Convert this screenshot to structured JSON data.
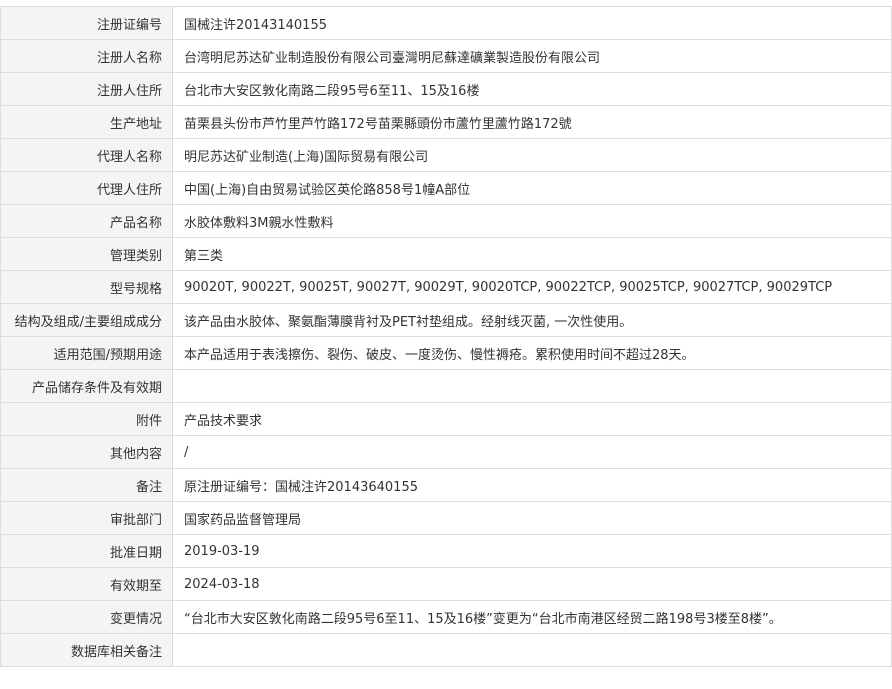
{
  "rows": [
    {
      "label": "注册证编号",
      "value": "国械注许20143140155"
    },
    {
      "label": "注册人名称",
      "value": "台湾明尼苏达矿业制造股份有限公司臺灣明尼蘇達礦業製造股份有限公司"
    },
    {
      "label": "注册人住所",
      "value": "台北市大安区敦化南路二段95号6至11、15及16楼"
    },
    {
      "label": "生产地址",
      "value": "苗栗县头份市芦竹里芦竹路172号苗栗縣頭份市蘆竹里蘆竹路172號"
    },
    {
      "label": "代理人名称",
      "value": "明尼苏达矿业制造(上海)国际贸易有限公司"
    },
    {
      "label": "代理人住所",
      "value": "中国(上海)自由贸易试验区英伦路858号1幢A部位"
    },
    {
      "label": "产品名称",
      "value": "水胶体敷料3M親水性敷料"
    },
    {
      "label": "管理类别",
      "value": "第三类"
    },
    {
      "label": "型号规格",
      "value": "90020T, 90022T, 90025T, 90027T, 90029T, 90020TCP, 90022TCP, 90025TCP, 90027TCP, 90029TCP"
    },
    {
      "label": "结构及组成/主要组成成分",
      "value": "该产品由水胶体、聚氨酯薄膜背衬及PET衬垫组成。经射线灭菌, 一次性使用。"
    },
    {
      "label": "适用范围/预期用途",
      "value": "本产品适用于表浅擦伤、裂伤、破皮、一度烫伤、慢性褥疮。累积使用时间不超过28天。"
    },
    {
      "label": "产品储存条件及有效期",
      "value": ""
    },
    {
      "label": "附件",
      "value": "产品技术要求"
    },
    {
      "label": "其他内容",
      "value": "/"
    },
    {
      "label": "备注",
      "value": "原注册证编号：国械注许20143640155"
    },
    {
      "label": "审批部门",
      "value": "国家药品监督管理局"
    },
    {
      "label": "批准日期",
      "value": "2019-03-19"
    },
    {
      "label": "有效期至",
      "value": "2024-03-18"
    },
    {
      "label": "变更情况",
      "value": "“台北市大安区敦化南路二段95号6至11、15及16楼”变更为“台北市南港区经贸二路198号3楼至8楼”。"
    },
    {
      "label": "数据库相关备注",
      "value": ""
    }
  ]
}
